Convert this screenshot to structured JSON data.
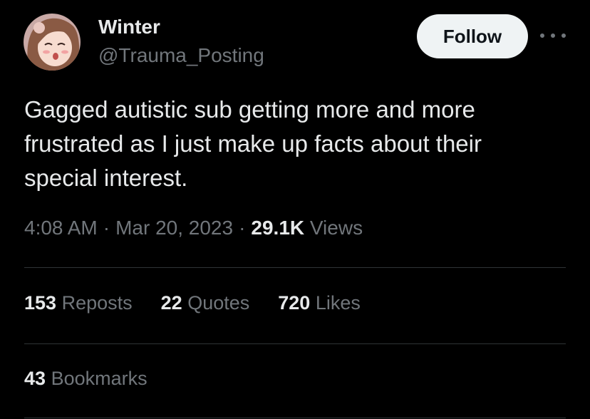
{
  "author": {
    "name": "Winter",
    "handle": "@Trauma_Posting",
    "avatar_icon": "anime-girl-avatar-icon"
  },
  "follow_label": "Follow",
  "more_icon": "more-horizontal-icon",
  "tweet": {
    "text": "Gagged autistic sub getting more and more frustrated as I just make up facts about their special interest."
  },
  "meta": {
    "time": "4:08 AM",
    "date": "Mar 20, 2023",
    "views_count": "29.1K",
    "views_label": "Views",
    "separator": "·"
  },
  "stats": {
    "reposts": {
      "count": "153",
      "label": "Reposts"
    },
    "quotes": {
      "count": "22",
      "label": "Quotes"
    },
    "likes": {
      "count": "720",
      "label": "Likes"
    },
    "bookmarks": {
      "count": "43",
      "label": "Bookmarks"
    }
  },
  "colors": {
    "background": "#000000",
    "primary_text": "#e7e9ea",
    "secondary_text": "#71767b",
    "divider": "#2f3336",
    "follow_button_bg": "#eff3f4"
  }
}
